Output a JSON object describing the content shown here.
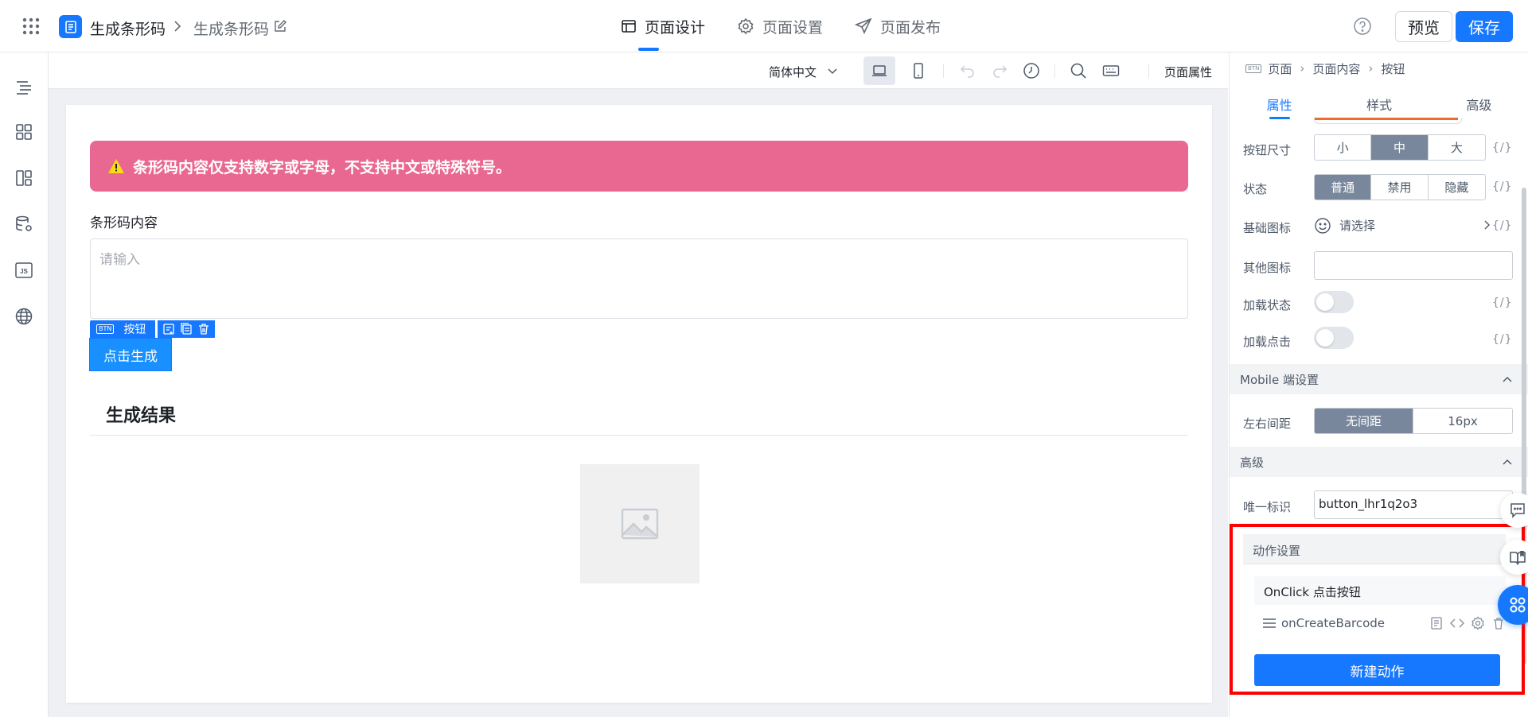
{
  "header": {
    "app_title": "生成条形码",
    "page_title": "生成条形码",
    "tabs": [
      {
        "label": "页面设计",
        "active": true
      },
      {
        "label": "页面设置",
        "active": false
      },
      {
        "label": "页面发布",
        "active": false
      }
    ],
    "preview_label": "预览",
    "save_label": "保存"
  },
  "toolbar": {
    "language": "简体中文",
    "page_props_label": "页面属性"
  },
  "canvas": {
    "alert_text": "条形码内容仅支持数字或字母，不支持中文或特殊符号。",
    "field_label": "条形码内容",
    "textarea_placeholder": "请输入",
    "selection_tag_icon": "BTN",
    "selection_tag_label": "按钮",
    "generate_button": "点击生成",
    "result_title": "生成结果"
  },
  "panel": {
    "breadcrumb": {
      "icon_text": "BTN",
      "items": [
        "页面",
        "页面内容",
        "按钮"
      ]
    },
    "tabs": [
      "属性",
      "样式",
      "高级"
    ],
    "button_size": {
      "label": "按钮尺寸",
      "options": [
        "小",
        "中",
        "大"
      ],
      "selected": "中"
    },
    "state": {
      "label": "状态",
      "options": [
        "普通",
        "禁用",
        "隐藏"
      ],
      "selected": "普通"
    },
    "base_icon": {
      "label": "基础图标",
      "value": "请选择"
    },
    "other_icon": {
      "label": "其他图标",
      "value": ""
    },
    "loading_state": {
      "label": "加载状态",
      "on": false
    },
    "loading_click": {
      "label": "加载点击",
      "on": false
    },
    "mobile_group": "Mobile 端设置",
    "lr_spacing": {
      "label": "左右间距",
      "options": [
        "无间距",
        "16px"
      ],
      "selected": "无间距"
    },
    "advanced_group": "高级",
    "unique_id": {
      "label": "唯一标识",
      "value": "button_lhr1q2o3"
    },
    "action_group": "动作设置",
    "event_label": "OnClick 点击按钮",
    "action_name": "onCreateBarcode",
    "new_action_label": "新建动作",
    "fx_label": "{/}"
  },
  "colors": {
    "primary": "#1677ff",
    "alert": "#e96891",
    "segment_on": "#79879c",
    "highlight": "#ff0000"
  }
}
